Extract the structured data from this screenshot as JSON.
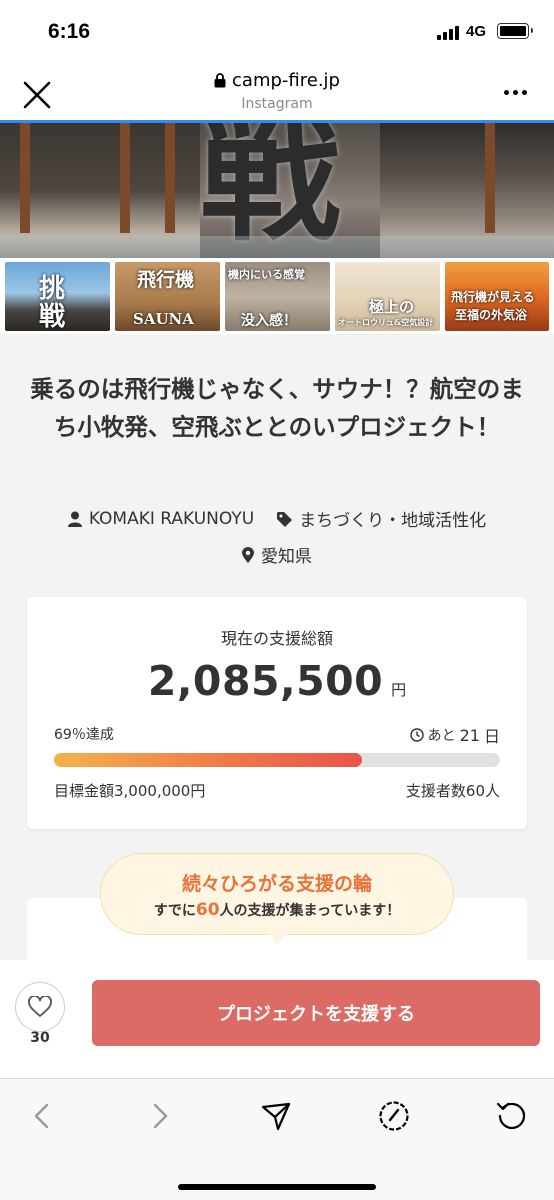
{
  "status_bar": {
    "time": "6:16",
    "network": "4G"
  },
  "browser": {
    "url": "camp-fire.jp",
    "subtitle": "Instagram"
  },
  "hero": {
    "kanji": "戦"
  },
  "thumbnails": [
    {
      "caption_1": "挑",
      "caption_2": "戦"
    },
    {
      "caption_1": "飛行機",
      "caption_2": "SAUNA"
    },
    {
      "caption_1": "機内にいる感覚",
      "caption_2": "没入感！"
    },
    {
      "caption_1": "極上の",
      "caption_2": "オートロウリュ&空気設計"
    },
    {
      "caption_1": "飛行機が見える",
      "caption_2": "至福の外気浴"
    }
  ],
  "project": {
    "title": "乗るのは飛行機じゃなく、サウナ！？航空のまち小牧発、空飛ぶととのいプロジェクト！",
    "owner": "KOMAKI RAKUNOYU",
    "category": "まちづくり・地域活性化",
    "location": "愛知県"
  },
  "funding": {
    "label": "現在の支援総額",
    "amount": "2,085,500",
    "unit": "円",
    "percent": 69,
    "percent_label": "％達成",
    "days_prefix": "あと",
    "days_value": "21",
    "days_unit": "日",
    "goal": "目標金額3,000,000円",
    "backers": "支援者数60人"
  },
  "bubble": {
    "title": "続々ひろがる支援の輪",
    "sub_prefix": "すでに",
    "sub_count": "60",
    "sub_suffix": "人の支援が集まっています！"
  },
  "actions": {
    "like_count": "30",
    "support_label": "プロジェクトを支援する"
  },
  "colors": {
    "accent": "#dc6a65",
    "progress_start": "#f5b24a",
    "progress_end": "#e9534a",
    "bubble_text": "#e8723a",
    "link_blue": "#2e8ff0"
  },
  "icons": [
    "close-icon",
    "lock-icon",
    "more-icon",
    "user-icon",
    "tag-icon",
    "pin-icon",
    "clock-icon",
    "heart-icon",
    "back-icon",
    "forward-icon",
    "share-icon",
    "compass-icon",
    "reload-icon"
  ]
}
